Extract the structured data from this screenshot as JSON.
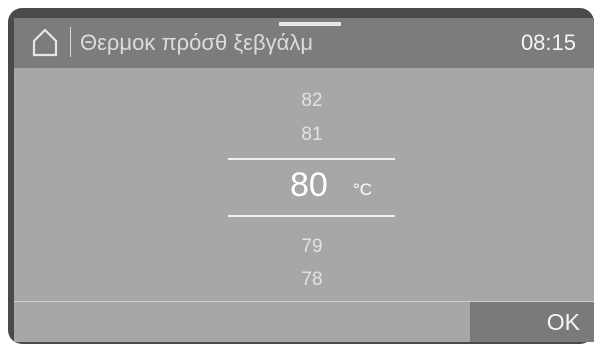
{
  "header": {
    "title": "Θερμοκ πρόσθ ξεβγάλμ",
    "time": "08:15"
  },
  "picker": {
    "values_above": [
      "82",
      "81"
    ],
    "selected_value": "80",
    "unit": "°C",
    "values_below": [
      "79",
      "78"
    ]
  },
  "footer": {
    "ok_label": "OK"
  },
  "icons": {
    "home": "home-icon"
  }
}
